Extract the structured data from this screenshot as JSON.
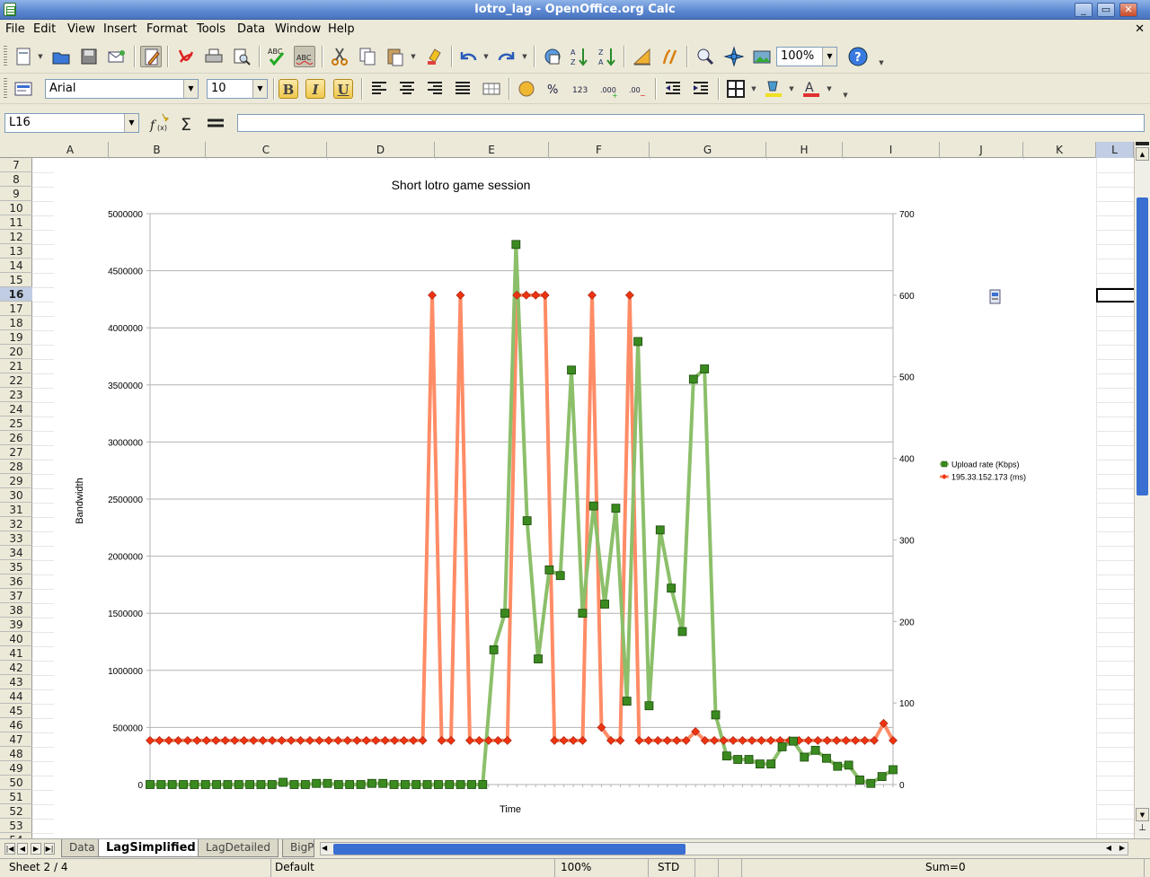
{
  "window": {
    "title": "lotro_lag - OpenOffice.org Calc"
  },
  "menu": [
    "File",
    "Edit",
    "View",
    "Insert",
    "Format",
    "Tools",
    "Data",
    "Window",
    "Help"
  ],
  "toolbar": {
    "zoom": "100%",
    "font_name": "Arial",
    "font_size": "10",
    "bold": "B",
    "italic": "I",
    "underline": "U"
  },
  "formula": {
    "cell_ref": "L16",
    "content": ""
  },
  "columns": [
    "A",
    "B",
    "C",
    "D",
    "E",
    "F",
    "G",
    "H",
    "I",
    "J",
    "K",
    "L"
  ],
  "rows": [
    "7",
    "8",
    "9",
    "10",
    "11",
    "12",
    "13",
    "14",
    "15",
    "16",
    "17",
    "18",
    "19",
    "20",
    "21",
    "22",
    "23",
    "24",
    "25",
    "26",
    "27",
    "28",
    "29",
    "30",
    "31",
    "32",
    "33",
    "34",
    "35",
    "36",
    "37",
    "38",
    "39",
    "40",
    "41",
    "42",
    "43",
    "44",
    "45",
    "46",
    "47",
    "48",
    "49",
    "50",
    "51",
    "52",
    "53",
    "54"
  ],
  "selected": {
    "row": "16",
    "column": "L"
  },
  "sheets": [
    "Data",
    "LagSimplified",
    "LagDetailed",
    "BigP"
  ],
  "active_sheet": "LagSimplified",
  "status": {
    "sheet": "Sheet 2 / 4",
    "style": "Default",
    "zoom": "100%",
    "mode": "STD",
    "sum": "Sum=0"
  },
  "chart_data": {
    "type": "line",
    "title": "Short lotro game session",
    "xlabel": "Time",
    "ylabel": "Bandwidth",
    "ylim": [
      0,
      5000000
    ],
    "y_ticks": [
      "0",
      "500000",
      "1000000",
      "1500000",
      "2000000",
      "2500000",
      "3000000",
      "3500000",
      "4000000",
      "4500000",
      "5000000"
    ],
    "y2lim": [
      0,
      700
    ],
    "y2_ticks": [
      "0",
      "100",
      "200",
      "300",
      "400",
      "500",
      "600",
      "700"
    ],
    "legend_position": "right",
    "grid": true,
    "series": [
      {
        "name": "Upload rate (Kbps)",
        "axis": "left",
        "color": "#8cbf6a",
        "marker_color": "#3a8a1f",
        "values": [
          0,
          0,
          0,
          0,
          0,
          0,
          0,
          0,
          0,
          0,
          0,
          0,
          20000,
          0,
          0,
          10000,
          10000,
          0,
          0,
          0,
          10000,
          10000,
          0,
          0,
          0,
          0,
          0,
          0,
          0,
          0,
          0,
          1180000,
          1500000,
          4730000,
          2310000,
          1100000,
          1880000,
          1830000,
          3630000,
          1500000,
          2440000,
          1580000,
          2420000,
          730000,
          3880000,
          690000,
          2230000,
          1720000,
          1340000,
          3550000,
          3640000,
          610000,
          250000,
          220000,
          220000,
          180000,
          180000,
          330000,
          380000,
          240000,
          300000,
          230000,
          160000,
          170000,
          40000,
          10000,
          70000,
          130000
        ]
      },
      {
        "name": "195.33.152.173 (ms)",
        "axis": "right",
        "color": "#ff8c66",
        "marker_color": "#ee3311",
        "values": [
          54,
          54,
          54,
          54,
          54,
          54,
          54,
          54,
          54,
          54,
          54,
          54,
          54,
          54,
          54,
          54,
          54,
          54,
          54,
          54,
          54,
          54,
          54,
          54,
          54,
          54,
          54,
          54,
          54,
          54,
          600,
          54,
          54,
          600,
          54,
          54,
          54,
          54,
          54,
          600,
          600,
          600,
          600,
          54,
          54,
          54,
          54,
          600,
          70,
          54,
          54,
          600,
          54,
          54,
          54,
          54,
          54,
          54,
          65,
          54,
          54,
          54,
          54,
          54,
          54,
          54,
          54,
          54,
          54,
          54,
          54,
          54,
          54,
          54,
          54,
          54,
          54,
          54,
          75,
          54
        ]
      }
    ]
  }
}
